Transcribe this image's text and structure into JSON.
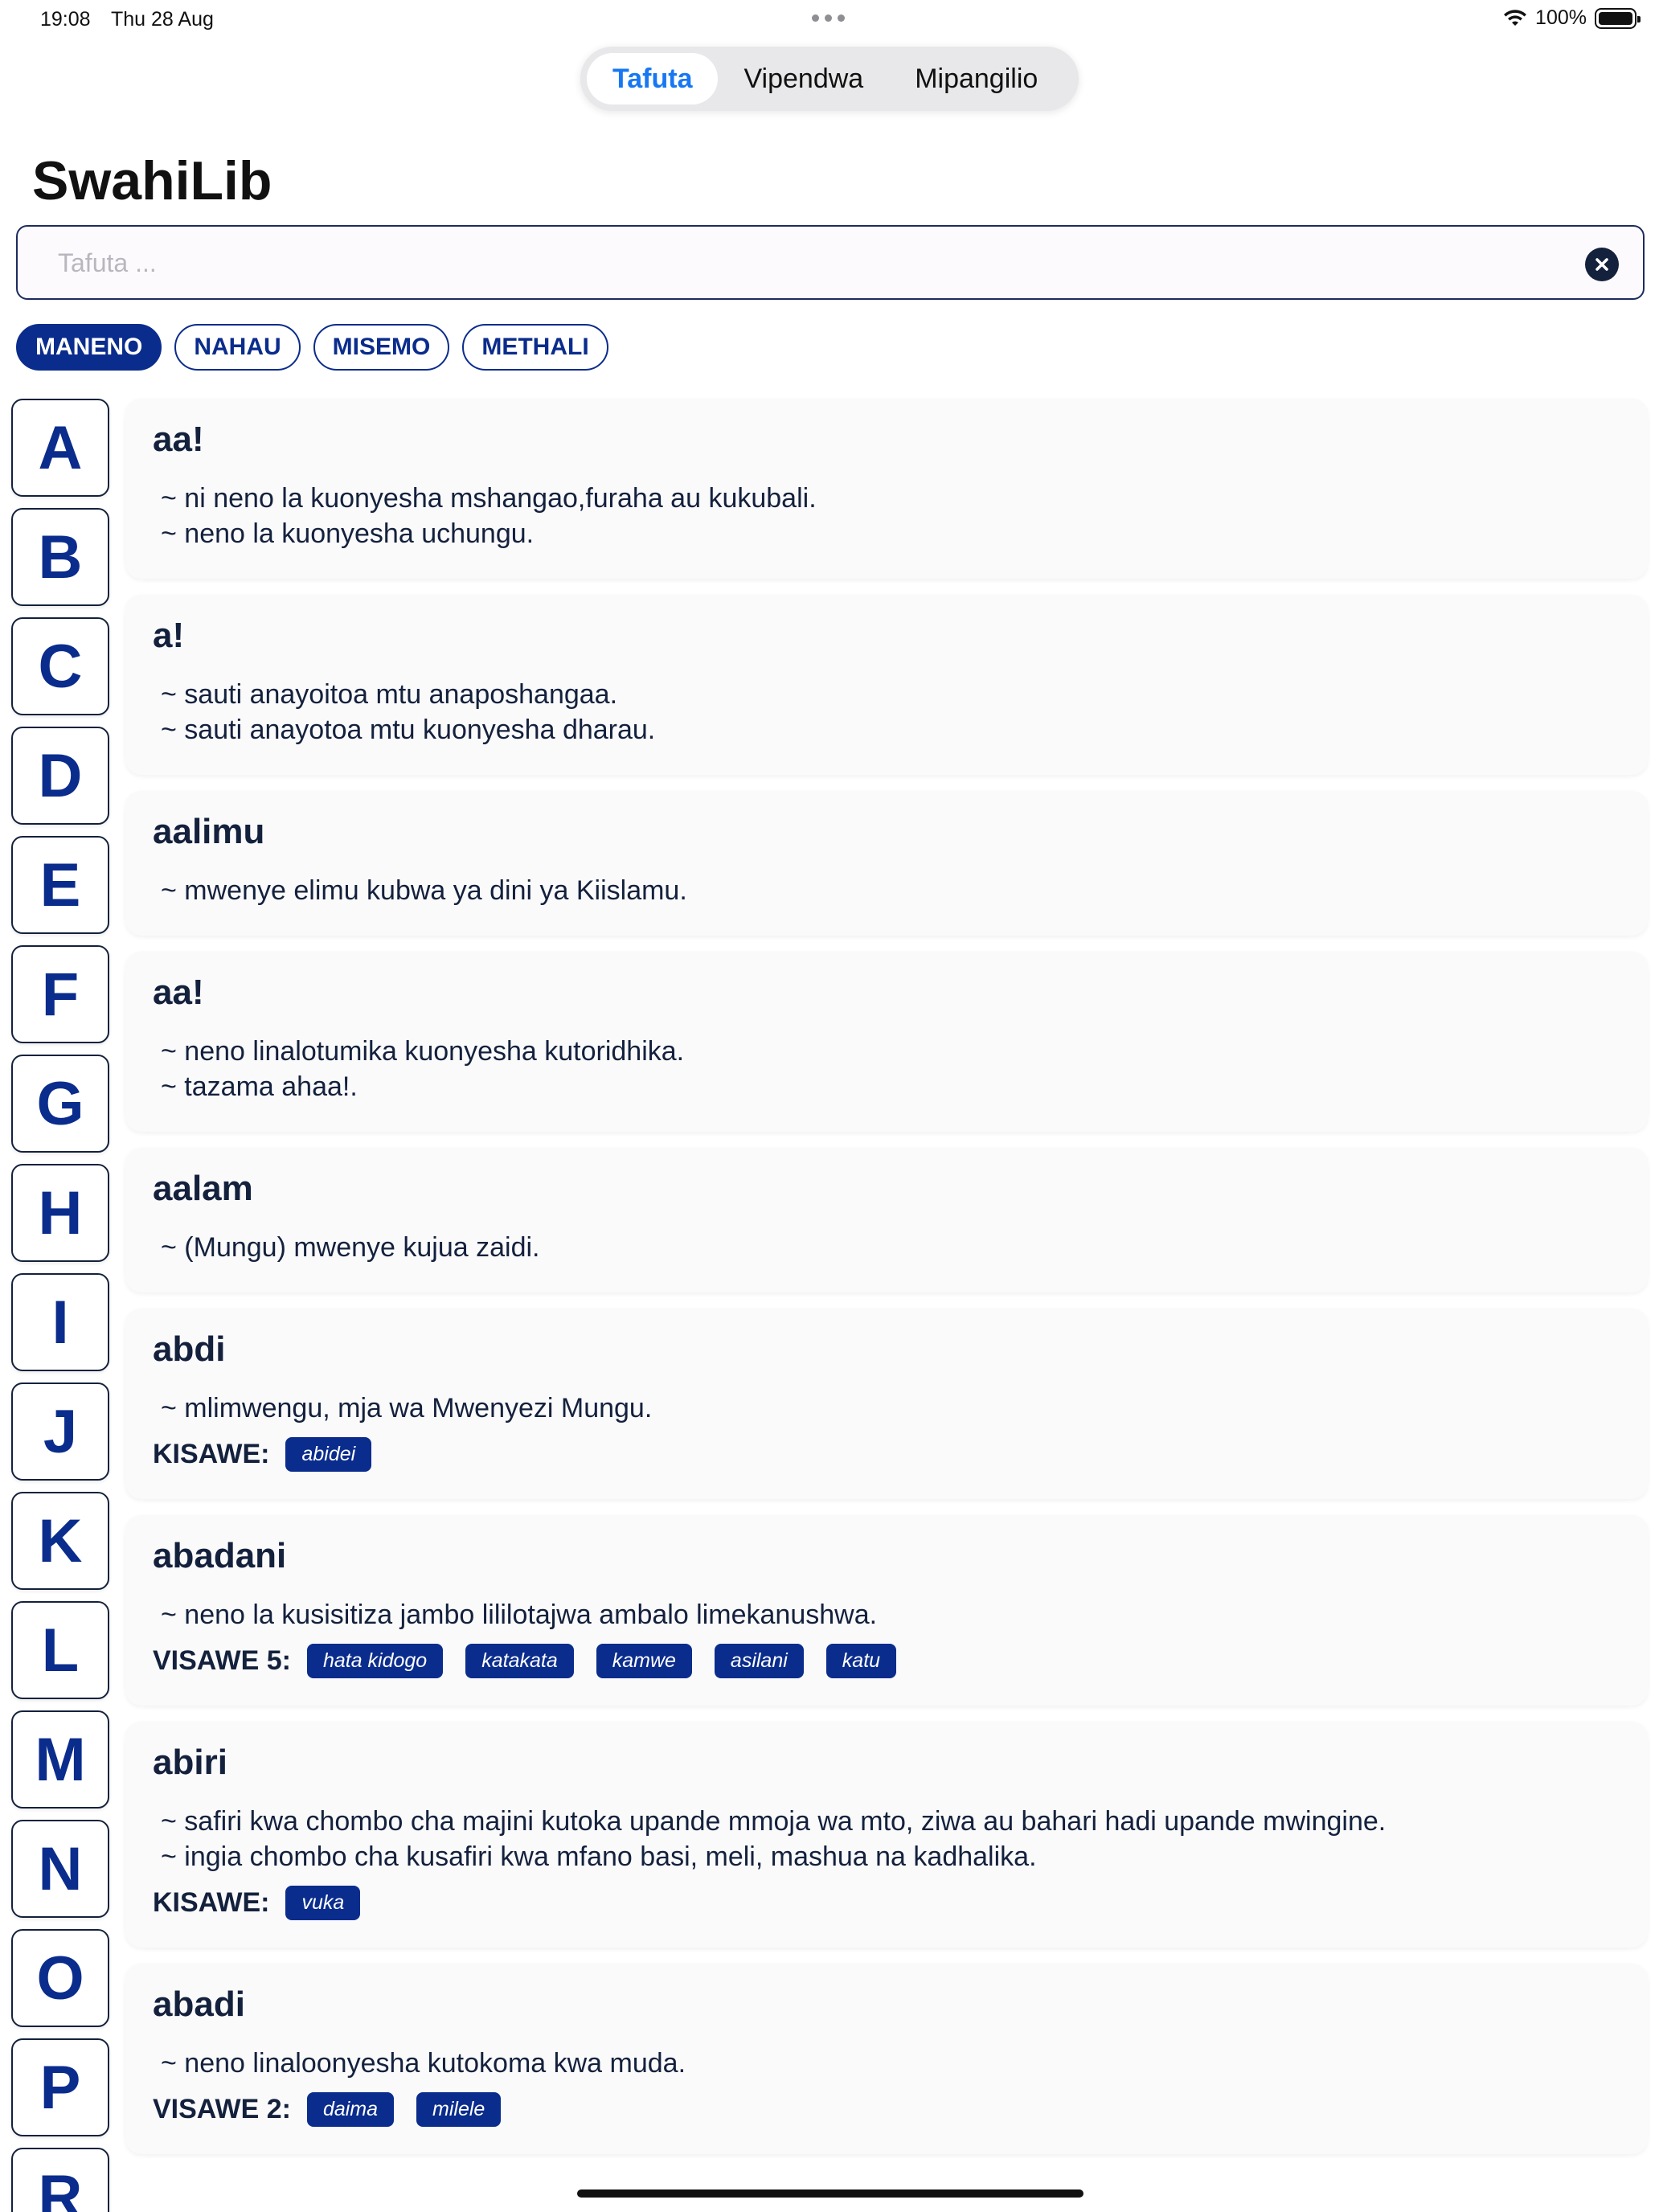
{
  "status": {
    "time": "19:08",
    "date": "Thu 28 Aug",
    "battery": "100%",
    "battery_level": 1.0
  },
  "tabs": [
    {
      "label": "Tafuta",
      "active": true
    },
    {
      "label": "Vipendwa",
      "active": false
    },
    {
      "label": "Mipangilio",
      "active": false
    }
  ],
  "app_title": "SwahiLib",
  "search": {
    "placeholder": "Tafuta ...",
    "value": ""
  },
  "filters": [
    {
      "label": "MANENO",
      "active": true
    },
    {
      "label": "NAHAU",
      "active": false
    },
    {
      "label": "MISEMO",
      "active": false
    },
    {
      "label": "METHALI",
      "active": false
    }
  ],
  "alphabet": [
    "A",
    "B",
    "C",
    "D",
    "E",
    "F",
    "G",
    "H",
    "I",
    "J",
    "K",
    "L",
    "M",
    "N",
    "O",
    "P",
    "R"
  ],
  "entries": [
    {
      "word": "aa!",
      "definitions": [
        "~ ni neno la kuonyesha mshangao,furaha au kukubali.",
        "~ neno la kuonyesha uchungu."
      ]
    },
    {
      "word": "a!",
      "definitions": [
        "~ sauti anayoitoa mtu anaposhangaa.",
        "~ sauti anayotoa mtu kuonyesha dharau."
      ]
    },
    {
      "word": "aalimu",
      "definitions": [
        "~ mwenye elimu kubwa ya dini ya Kiislamu."
      ]
    },
    {
      "word": "aa!",
      "definitions": [
        "~ neno linalotumika kuonyesha kutoridhika.",
        "~ tazama ahaa!."
      ]
    },
    {
      "word": "aalam",
      "definitions": [
        "~ (Mungu) mwenye kujua zaidi."
      ]
    },
    {
      "word": "abdi",
      "definitions": [
        "~ mlimwengu, mja wa Mwenyezi Mungu."
      ],
      "synonym_label": "KISAWE:",
      "synonyms": [
        "abidei"
      ]
    },
    {
      "word": "abadani",
      "definitions": [
        "~ neno la kusisitiza jambo lililotajwa ambalo limekanushwa."
      ],
      "synonym_label": "VISAWE 5:",
      "synonyms": [
        "hata kidogo",
        "katakata",
        "kamwe",
        "asilani",
        "katu"
      ]
    },
    {
      "word": "abiri",
      "definitions": [
        "~ safiri kwa chombo cha majini kutoka upande mmoja wa mto, ziwa au bahari hadi upande mwingine.",
        "~ ingia chombo cha kusafiri kwa mfano basi, meli, mashua na kadhalika."
      ],
      "synonym_label": "KISAWE:",
      "synonyms": [
        "vuka"
      ]
    },
    {
      "word": "abadi",
      "definitions": [
        "~ neno linaloonyesha kutokoma kwa muda."
      ],
      "synonym_label": "VISAWE 2:",
      "synonyms": [
        "daima",
        "milele"
      ]
    }
  ]
}
